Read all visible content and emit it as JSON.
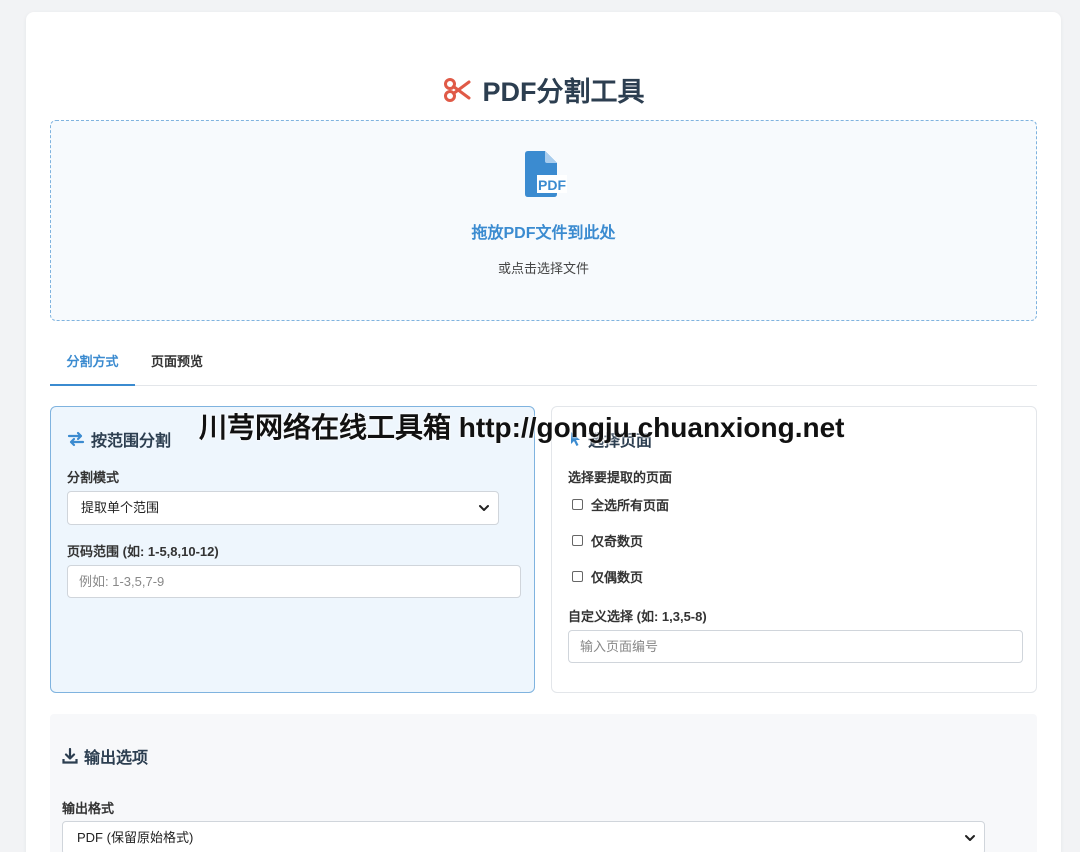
{
  "app": {
    "title": "PDF分割工具"
  },
  "dropzone": {
    "icon_label": "PDF",
    "title": "拖放PDF文件到此处",
    "subtitle": "或点击选择文件"
  },
  "tabs": [
    {
      "label": "分割方式",
      "active": true
    },
    {
      "label": "页面预览",
      "active": false
    }
  ],
  "range_panel": {
    "heading": "按范围分割",
    "mode_label": "分割模式",
    "mode_value": "提取单个范围",
    "range_label": "页码范围 (如: 1-5,8,10-12)",
    "range_placeholder": "例如: 1-3,5,7-9"
  },
  "select_panel": {
    "heading": "选择页面",
    "extract_label": "选择要提取的页面",
    "options": [
      {
        "label": "全选所有页面",
        "checked": false
      },
      {
        "label": "仅奇数页",
        "checked": false
      },
      {
        "label": "仅偶数页",
        "checked": false
      }
    ],
    "custom_label": "自定义选择 (如: 1,3,5-8)",
    "custom_placeholder": "输入页面编号"
  },
  "output": {
    "heading": "输出选项",
    "format_label": "输出格式",
    "format_value": "PDF (保留原始格式)"
  },
  "watermark": "川芎网络在线工具箱 http://gongju.chuanxiong.net",
  "colors": {
    "accent": "#3b8bd0",
    "title_icon": "#e05a47",
    "text": "#2c3e50"
  }
}
